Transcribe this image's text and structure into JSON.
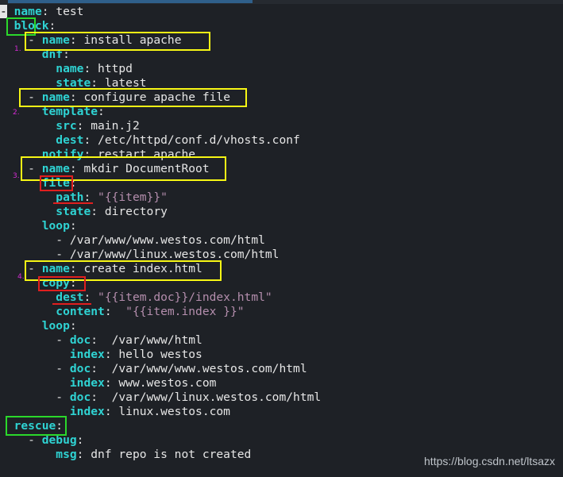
{
  "lines": [
    {
      "indent": "",
      "dash": "-",
      "key": "name",
      "sep": ": ",
      "val": "test",
      "vtype": "val"
    },
    {
      "indent": "  ",
      "dash": "",
      "key": "block",
      "sep": ":",
      "val": "",
      "vtype": "val"
    },
    {
      "indent": "    ",
      "dash": "- ",
      "key": "name",
      "sep": ": ",
      "val": "install apache",
      "vtype": "val"
    },
    {
      "indent": "      ",
      "dash": "",
      "key": "dnf",
      "sep": ":",
      "val": "",
      "vtype": "val"
    },
    {
      "indent": "        ",
      "dash": "",
      "key": "name",
      "sep": ": ",
      "val": "httpd",
      "vtype": "val"
    },
    {
      "indent": "        ",
      "dash": "",
      "key": "state",
      "sep": ": ",
      "val": "latest",
      "vtype": "val"
    },
    {
      "indent": "    ",
      "dash": "- ",
      "key": "name",
      "sep": ": ",
      "val": "configure apache file",
      "vtype": "val"
    },
    {
      "indent": "      ",
      "dash": "",
      "key": "template",
      "sep": ":",
      "val": "",
      "vtype": "val"
    },
    {
      "indent": "        ",
      "dash": "",
      "key": "src",
      "sep": ": ",
      "val": "main.j2",
      "vtype": "val"
    },
    {
      "indent": "        ",
      "dash": "",
      "key": "dest",
      "sep": ": ",
      "val": "/etc/httpd/conf.d/vhosts.conf",
      "vtype": "val"
    },
    {
      "indent": "      ",
      "dash": "",
      "key": "notify",
      "sep": ": ",
      "val": "restart apache",
      "vtype": "val"
    },
    {
      "indent": "    ",
      "dash": "- ",
      "key": "name",
      "sep": ": ",
      "val": "mkdir DocumentRoot",
      "vtype": "val"
    },
    {
      "indent": "      ",
      "dash": "",
      "key": "file",
      "sep": ":",
      "val": "",
      "vtype": "val"
    },
    {
      "indent": "        ",
      "dash": "",
      "key": "path",
      "sep": ": ",
      "val": "\"{{item}}\"",
      "vtype": "str"
    },
    {
      "indent": "        ",
      "dash": "",
      "key": "state",
      "sep": ": ",
      "val": "directory",
      "vtype": "val"
    },
    {
      "indent": "      ",
      "dash": "",
      "key": "loop",
      "sep": ":",
      "val": "",
      "vtype": "val"
    },
    {
      "indent": "        ",
      "dash": "- ",
      "key": "",
      "sep": "",
      "val": "/var/www/www.westos.com/html",
      "vtype": "val"
    },
    {
      "indent": "        ",
      "dash": "- ",
      "key": "",
      "sep": "",
      "val": "/var/www/linux.westos.com/html",
      "vtype": "val"
    },
    {
      "indent": "    ",
      "dash": "- ",
      "key": "name",
      "sep": ": ",
      "val": "create index.html",
      "vtype": "val"
    },
    {
      "indent": "      ",
      "dash": "",
      "key": "copy",
      "sep": ":",
      "val": "",
      "vtype": "val"
    },
    {
      "indent": "        ",
      "dash": "",
      "key": "dest",
      "sep": ": ",
      "val": "\"{{item.doc}}/index.html\"",
      "vtype": "str"
    },
    {
      "indent": "        ",
      "dash": "",
      "key": "content",
      "sep": ":  ",
      "val": "\"{{item.index }}\"",
      "vtype": "str"
    },
    {
      "indent": "      ",
      "dash": "",
      "key": "loop",
      "sep": ":",
      "val": "",
      "vtype": "val"
    },
    {
      "indent": "        ",
      "dash": "- ",
      "key": "doc",
      "sep": ":  ",
      "val": "/var/www/html",
      "vtype": "val"
    },
    {
      "indent": "          ",
      "dash": "",
      "key": "index",
      "sep": ": ",
      "val": "hello westos",
      "vtype": "val"
    },
    {
      "indent": "        ",
      "dash": "- ",
      "key": "doc",
      "sep": ":  ",
      "val": "/var/www/www.westos.com/html",
      "vtype": "val"
    },
    {
      "indent": "          ",
      "dash": "",
      "key": "index",
      "sep": ": ",
      "val": "www.westos.com",
      "vtype": "val"
    },
    {
      "indent": "        ",
      "dash": "- ",
      "key": "doc",
      "sep": ":  ",
      "val": "/var/www/linux.westos.com/html",
      "vtype": "val"
    },
    {
      "indent": "          ",
      "dash": "",
      "key": "index",
      "sep": ": ",
      "val": "linux.westos.com",
      "vtype": "val"
    },
    {
      "indent": "  ",
      "dash": "",
      "key": "rescue",
      "sep": ":",
      "val": "",
      "vtype": "val"
    },
    {
      "indent": "    ",
      "dash": "- ",
      "key": "debug",
      "sep": ":",
      "val": "",
      "vtype": "val"
    },
    {
      "indent": "        ",
      "dash": "",
      "key": "msg",
      "sep": ": ",
      "val": "dnf repo is not created",
      "vtype": "val"
    }
  ],
  "annotations": {
    "step1": "1.",
    "step2": "2.",
    "step3": "3.",
    "step4": "4."
  },
  "watermark": "https://blog.csdn.net/ltsazx",
  "colors": {
    "background": "#1e2126",
    "key": "#2fd3d3",
    "string": "#b48ead",
    "highlight_yellow": "#f7f715",
    "highlight_green": "#2bd82b",
    "highlight_red": "#e01f1f",
    "step_number": "#d42bd4"
  }
}
